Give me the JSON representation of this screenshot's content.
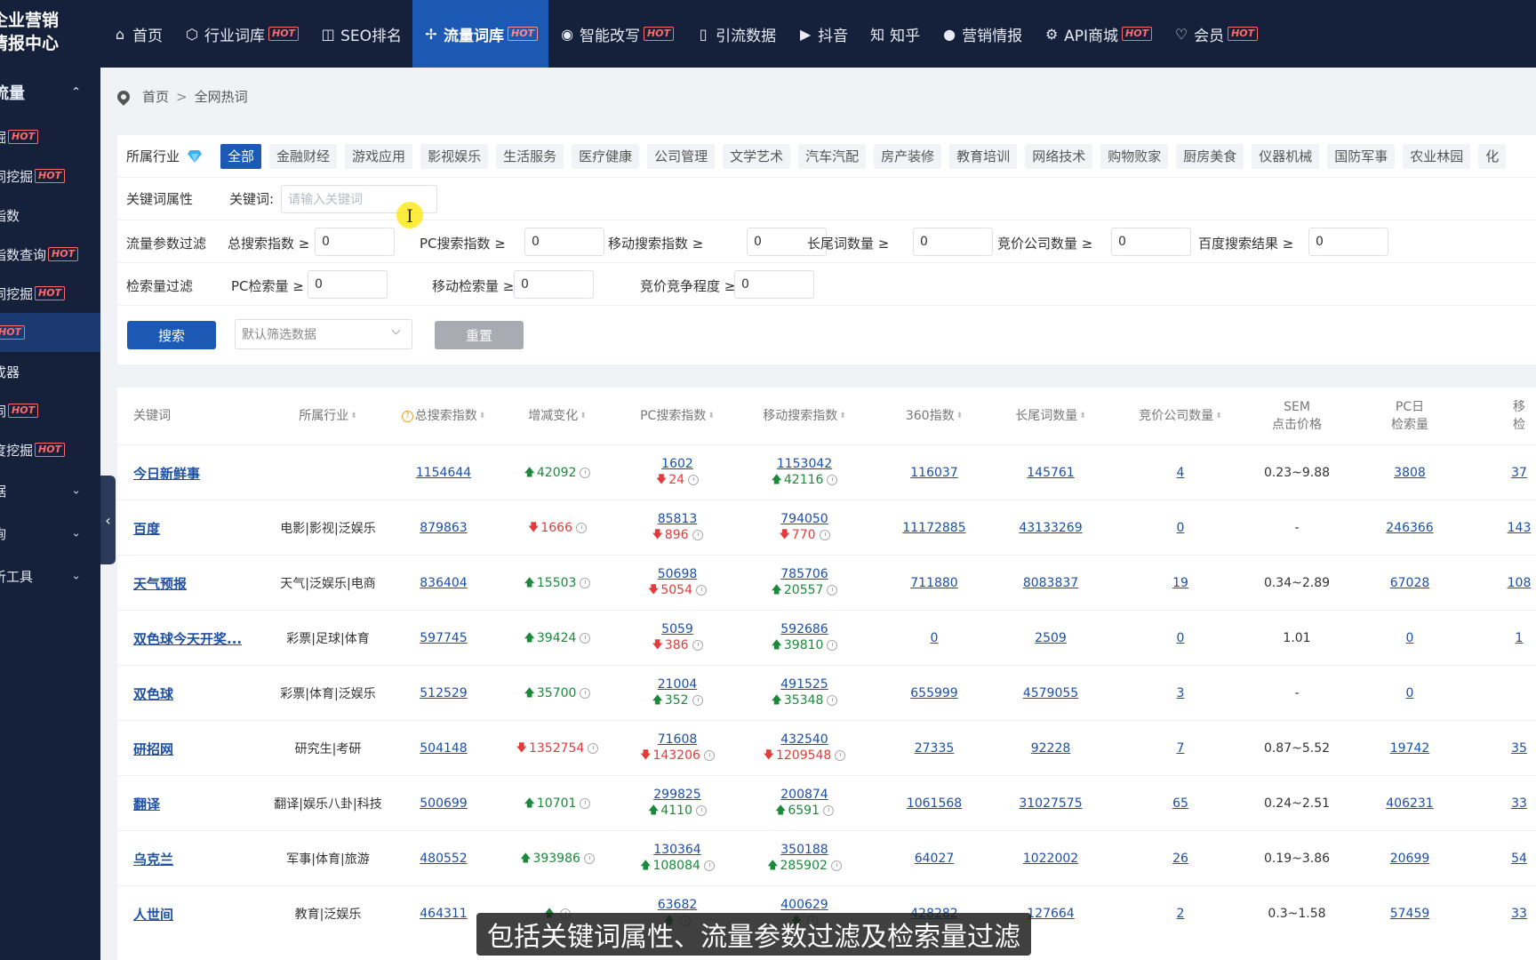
{
  "logo": {
    "line1": "企业营销",
    "line2": "情报中心"
  },
  "nav": [
    {
      "icon": "⌂",
      "label": "首页",
      "hot": false
    },
    {
      "icon": "⬡",
      "label": "行业词库",
      "hot": true
    },
    {
      "icon": "◫",
      "label": "SEO排名",
      "hot": false
    },
    {
      "icon": "✢",
      "label": "流量词库",
      "hot": true
    },
    {
      "icon": "◉",
      "label": "智能改写",
      "hot": true
    },
    {
      "icon": "▯",
      "label": "引流数据",
      "hot": false
    },
    {
      "icon": "▶",
      "label": "抖音",
      "hot": false
    },
    {
      "icon": "知",
      "label": "知乎",
      "hot": false
    },
    {
      "icon": "●",
      "label": "营销情报",
      "hot": false
    },
    {
      "icon": "⚙",
      "label": "API商城",
      "hot": true
    },
    {
      "icon": "♡",
      "label": "会员",
      "hot": true
    }
  ],
  "hot_label": "HOT",
  "sidebar": {
    "group": "流量",
    "items": [
      {
        "label": "掘",
        "hot": true
      },
      {
        "label": "词挖掘",
        "hot": true
      },
      {
        "label": "指数",
        "hot": false
      },
      {
        "label": "指数查询",
        "hot": true
      },
      {
        "label": "词挖掘",
        "hot": true
      },
      {
        "label": "",
        "hot": true
      },
      {
        "label": "成器",
        "hot": false
      },
      {
        "label": "词",
        "hot": true
      },
      {
        "label": "度挖掘",
        "hot": true
      }
    ],
    "groups_collapsed": [
      "据",
      "询",
      "析工具"
    ]
  },
  "breadcrumb": {
    "home": "首页",
    "sep": ">",
    "current": "全网热词"
  },
  "industry": {
    "label": "所属行业",
    "tags": [
      "全部",
      "金融财经",
      "游戏应用",
      "影视娱乐",
      "生活服务",
      "医疗健康",
      "公司管理",
      "文学艺术",
      "汽车汽配",
      "房产装修",
      "教育培训",
      "网络技术",
      "购物败家",
      "厨房美食",
      "仪器机械",
      "国防军事",
      "农业林园",
      "化"
    ]
  },
  "keyword_row": {
    "label": "关键词属性",
    "kw_label": "关键词:",
    "kw_placeholder": "请输入关键词"
  },
  "flow_row": {
    "label": "流量参数过滤",
    "fields": [
      {
        "label": "总搜索指数 ≥",
        "value": "0"
      },
      {
        "label": "PC搜索指数 ≥",
        "value": "0"
      },
      {
        "label": "移动搜索指数 ≥",
        "value": "0"
      },
      {
        "label": "长尾词数量 ≥",
        "value": "0"
      },
      {
        "label": "竞价公司数量 ≥",
        "value": "0"
      },
      {
        "label": "百度搜索结果 ≥",
        "value": "0"
      }
    ]
  },
  "retrieval_row": {
    "label": "检索量过滤",
    "fields": [
      {
        "label": "PC检索量 ≥",
        "value": "0"
      },
      {
        "label": "移动检索量 ≥",
        "value": "0"
      },
      {
        "label": "竞价竞争程度 ≥",
        "value": "0"
      }
    ]
  },
  "actions": {
    "search": "搜索",
    "select": "默认筛选数据",
    "reset": "重置"
  },
  "table": {
    "headers": {
      "keyword": "关键词",
      "industry": "所属行业",
      "total": "总搜索指数",
      "change": "增减变化",
      "pc": "PC搜索指数",
      "mobile": "移动搜索指数",
      "idx360": "360指数",
      "longtail": "长尾词数量",
      "bidco": "竞价公司数量",
      "sem1": "SEM",
      "sem2": "点击价格",
      "pcday1": "PC日",
      "pcday2": "检索量",
      "last1": "移",
      "last2": "检"
    },
    "rows": [
      {
        "kw": "今日新鲜事",
        "ind": "",
        "total": "1154644",
        "chg": "42092",
        "chgDir": "up",
        "pc": "1602",
        "pcChg": "24",
        "pcDir": "down",
        "mob": "1153042",
        "mobChg": "42116",
        "mobDir": "up",
        "i360": "116037",
        "lt": "145761",
        "bid": "4",
        "sem": "0.23~9.88",
        "pcday": "3808",
        "last": "37"
      },
      {
        "kw": "百度",
        "ind": "电影|影视|泛娱乐",
        "total": "879863",
        "chg": "1666",
        "chgDir": "down",
        "pc": "85813",
        "pcChg": "896",
        "pcDir": "down",
        "mob": "794050",
        "mobChg": "770",
        "mobDir": "down",
        "i360": "11172885",
        "lt": "43133269",
        "bid": "0",
        "sem": "-",
        "pcday": "246366",
        "last": "143"
      },
      {
        "kw": "天气预报",
        "ind": "天气|泛娱乐|电商",
        "total": "836404",
        "chg": "15503",
        "chgDir": "up",
        "pc": "50698",
        "pcChg": "5054",
        "pcDir": "down",
        "mob": "785706",
        "mobChg": "20557",
        "mobDir": "up",
        "i360": "711880",
        "lt": "8083837",
        "bid": "19",
        "sem": "0.34~2.89",
        "pcday": "67028",
        "last": "108"
      },
      {
        "kw": "双色球今天开奖...",
        "ind": "彩票|足球|体育",
        "total": "597745",
        "chg": "39424",
        "chgDir": "up",
        "pc": "5059",
        "pcChg": "386",
        "pcDir": "down",
        "mob": "592686",
        "mobChg": "39810",
        "mobDir": "up",
        "i360": "0",
        "lt": "2509",
        "bid": "0",
        "sem": "1.01",
        "pcday": "0",
        "last": "1"
      },
      {
        "kw": "双色球",
        "ind": "彩票|体育|泛娱乐",
        "total": "512529",
        "chg": "35700",
        "chgDir": "up",
        "pc": "21004",
        "pcChg": "352",
        "pcDir": "up",
        "mob": "491525",
        "mobChg": "35348",
        "mobDir": "up",
        "i360": "655999",
        "lt": "4579055",
        "bid": "3",
        "sem": "-",
        "pcday": "0",
        "last": ""
      },
      {
        "kw": "研招网",
        "ind": "研究生|考研",
        "total": "504148",
        "chg": "1352754",
        "chgDir": "down",
        "pc": "71608",
        "pcChg": "143206",
        "pcDir": "down",
        "mob": "432540",
        "mobChg": "1209548",
        "mobDir": "down",
        "i360": "27335",
        "lt": "92228",
        "bid": "7",
        "sem": "0.87~5.52",
        "pcday": "19742",
        "last": "35"
      },
      {
        "kw": "翻译",
        "ind": "翻译|娱乐八卦|科技",
        "total": "500699",
        "chg": "10701",
        "chgDir": "up",
        "pc": "299825",
        "pcChg": "4110",
        "pcDir": "up",
        "mob": "200874",
        "mobChg": "6591",
        "mobDir": "up",
        "i360": "1061568",
        "lt": "31027575",
        "bid": "65",
        "sem": "0.24~2.51",
        "pcday": "406231",
        "last": "33"
      },
      {
        "kw": "乌克兰",
        "ind": "军事|体育|旅游",
        "total": "480552",
        "chg": "393986",
        "chgDir": "up",
        "pc": "130364",
        "pcChg": "108084",
        "pcDir": "up",
        "mob": "350188",
        "mobChg": "285902",
        "mobDir": "up",
        "i360": "64027",
        "lt": "1022002",
        "bid": "26",
        "sem": "0.19~3.86",
        "pcday": "20699",
        "last": "54"
      },
      {
        "kw": "人世间",
        "ind": "教育|泛娱乐",
        "total": "464311",
        "chg": "",
        "chgDir": "up",
        "pc": "63682",
        "pcChg": "",
        "pcDir": "up",
        "mob": "400629",
        "mobChg": "",
        "mobDir": "up",
        "i360": "428282",
        "lt": "127664",
        "bid": "2",
        "sem": "0.3~1.58",
        "pcday": "57459",
        "last": "33"
      }
    ]
  },
  "subtitle": "包括关键词属性、流量参数过滤及检索量过滤",
  "colors": {
    "nav_bg": "#15203a",
    "accent": "#1c59b4",
    "hot": "#ff6b6b",
    "up": "#1a8a3a",
    "down": "#e33b3b",
    "link": "#1c4fa6"
  }
}
